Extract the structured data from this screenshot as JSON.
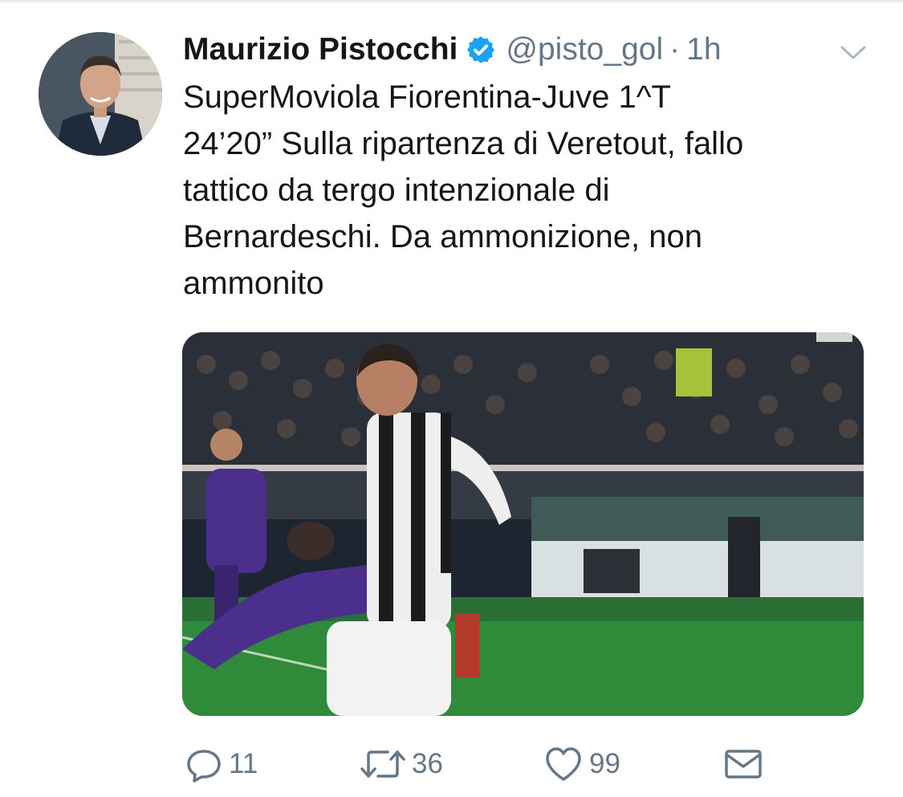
{
  "tweet": {
    "author_name": "Maurizio Pistocchi",
    "handle": "@pisto_gol",
    "separator": "·",
    "time": "1h",
    "text": "SuperMoviola Fiorentina-Juve 1^T\n24’20” Sulla ripartenza di Veretout, fallo\ntattico da tergo intenzionale di\nBernardeschi. Da ammonizione, non\nammonito"
  },
  "actions": {
    "replies": "11",
    "retweets": "36",
    "likes": "99"
  },
  "icons": {
    "verified": "verified-badge-icon",
    "menu": "chevron-down-icon",
    "reply": "reply-icon",
    "retweet": "retweet-icon",
    "like": "heart-icon",
    "message": "direct-message-icon"
  },
  "colors": {
    "verified_blue": "#1da1f2",
    "secondary_text": "#657786",
    "primary_text": "#14171a"
  }
}
